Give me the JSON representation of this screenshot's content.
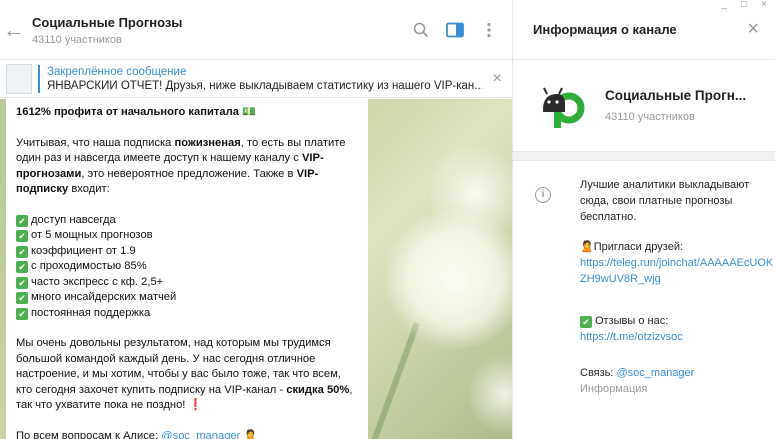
{
  "window": {
    "minimize": "_",
    "maximize": "□",
    "close": "×"
  },
  "header": {
    "back_icon": "←",
    "title": "Социальные Прогнозы",
    "subtitle": "43110 участников"
  },
  "pinned": {
    "title": "Закреплённое сообщение",
    "text": "ЯНВАРСКИЙ ОТЧЕТ! Друзья, ниже выкладываем статистику из нашего VIP-кан...",
    "close_icon": "×"
  },
  "message": {
    "headline": "1612% профита от начального капитала",
    "headline_emoji": "💵",
    "para1_a": "Учитывая, что наша подписка ",
    "para1_b": "пожизненая",
    "para1_c": ", то есть вы платите один раз и навсегда имеете доступ к нашему каналу с ",
    "para1_d": "VIP-прогнозами",
    "para1_e": ", это невероятное предложение. Также в ",
    "para1_f": "VIP-подписку",
    "para1_g": " входит:",
    "features": [
      "доступ навсегда",
      "от 5 мощных прогнозов",
      "коэффициент от 1.9",
      "с проходимостью 85%",
      "часто экспресс с кф. 2,5+",
      "много инсайдерских матчей",
      "постоянная поддержка"
    ],
    "check_glyph": "✔",
    "para2_a": "Мы очень довольны результатом, над которым мы трудимся большой командой каждый день. У нас сегодня отличное настроение, и мы хотим, чтобы у вас было тоже, так что всем, кто сегодня захочет купить подписку на VIP-канал - ",
    "para2_b": "скидка 50%",
    "para2_c": ", так что ухватите пока не поздно! ",
    "para2_mark": "❗",
    "contact_a": "По всем вопросам к Алисе: ",
    "contact_link": "@soc_manager",
    "contact_emoji": "🙎"
  },
  "panel": {
    "title": "Информация о канале",
    "close_icon": "×",
    "channel_name": "Социальные Прогн...",
    "members": "43110 участников",
    "info_icon": "i",
    "description": "Лучшие аналитики выкладывают сюда, свои платные прогнозы бесплатно.",
    "invite_emoji": "🙎",
    "invite_label": "Пригласи друзей:",
    "invite_link": "https://teleg.run/joinchat/AAAAAEcUOKZH9wUV8R_wjg",
    "reviews_check": "✔",
    "reviews_label": "Отзывы о нас:",
    "reviews_link": "https://t.me/otzizvsoc",
    "contact_label": "Связь: ",
    "contact_link": "@soc_manager",
    "info_label": "Информация"
  },
  "colors": {
    "accent": "#3a8ed1",
    "check": "#4caf50",
    "logo_green": "#2fae3c",
    "logo_dark": "#2a2a2a"
  }
}
